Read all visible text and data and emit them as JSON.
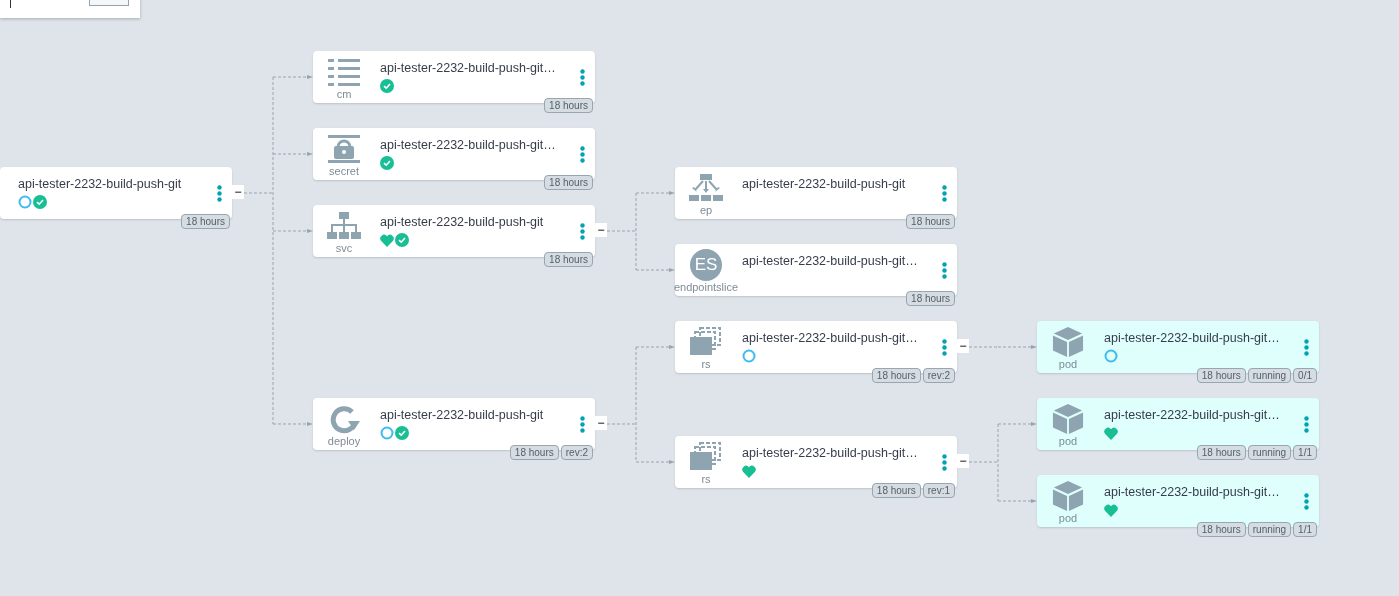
{
  "tree": {
    "name": "api-tester-2232-build-push-git",
    "statuses": [
      {
        "kind": "progressing"
      },
      {
        "kind": "synced"
      }
    ],
    "badges": [
      "18 hours"
    ],
    "collapse": "−",
    "highlighted": false,
    "children": [
      {
        "kind": "configmap",
        "kind_label": "cm",
        "name": "api-tester-2232-build-push-git…",
        "statuses": [
          {
            "kind": "synced"
          }
        ],
        "badges": [
          "18 hours"
        ],
        "highlighted": false
      },
      {
        "kind": "secret",
        "kind_label": "secret",
        "name": "api-tester-2232-build-push-git…",
        "statuses": [
          {
            "kind": "synced"
          }
        ],
        "badges": [
          "18 hours"
        ],
        "highlighted": false
      },
      {
        "kind": "service",
        "kind_label": "svc",
        "name": "api-tester-2232-build-push-git",
        "statuses": [
          {
            "kind": "healthy"
          },
          {
            "kind": "synced"
          }
        ],
        "badges": [
          "18 hours"
        ],
        "collapse": "−",
        "highlighted": false,
        "children": [
          {
            "kind": "endpoints",
            "kind_label": "ep",
            "name": "api-tester-2232-build-push-git",
            "badges": [
              "18 hours"
            ],
            "highlighted": false
          },
          {
            "kind": "initials",
            "icon_text": "ES",
            "kind_label": "endpointslice",
            "name": "api-tester-2232-build-push-git…",
            "badges": [
              "18 hours"
            ],
            "highlighted": false
          }
        ]
      },
      {
        "kind": "deployment",
        "kind_label": "deploy",
        "name": "api-tester-2232-build-push-git",
        "statuses": [
          {
            "kind": "progressing"
          },
          {
            "kind": "synced"
          }
        ],
        "badges": [
          "18 hours",
          "rev:2"
        ],
        "collapse": "−",
        "highlighted": false,
        "children": [
          {
            "kind": "replicaset",
            "kind_label": "rs",
            "name": "api-tester-2232-build-push-git…",
            "statuses": [
              {
                "kind": "progressing"
              }
            ],
            "badges": [
              "18 hours",
              "rev:2"
            ],
            "collapse": "−",
            "highlighted": false,
            "children": [
              {
                "kind": "pod",
                "kind_label": "pod",
                "name": "api-tester-2232-build-push-git…",
                "statuses": [
                  {
                    "kind": "progressing"
                  }
                ],
                "badges": [
                  "18 hours",
                  "running",
                  "0/1"
                ],
                "highlighted": true
              }
            ]
          },
          {
            "kind": "replicaset",
            "kind_label": "rs",
            "name": "api-tester-2232-build-push-git…",
            "statuses": [
              {
                "kind": "healthy"
              }
            ],
            "badges": [
              "18 hours",
              "rev:1"
            ],
            "collapse": "−",
            "highlighted": false,
            "children": [
              {
                "kind": "pod",
                "kind_label": "pod",
                "name": "api-tester-2232-build-push-git…",
                "statuses": [
                  {
                    "kind": "healthy"
                  }
                ],
                "badges": [
                  "18 hours",
                  "running",
                  "1/1"
                ],
                "highlighted": true
              },
              {
                "kind": "pod",
                "kind_label": "pod",
                "name": "api-tester-2232-build-push-git…",
                "statuses": [
                  {
                    "kind": "healthy"
                  }
                ],
                "badges": [
                  "18 hours",
                  "running",
                  "1/1"
                ],
                "highlighted": true
              }
            ]
          }
        ]
      }
    ]
  }
}
